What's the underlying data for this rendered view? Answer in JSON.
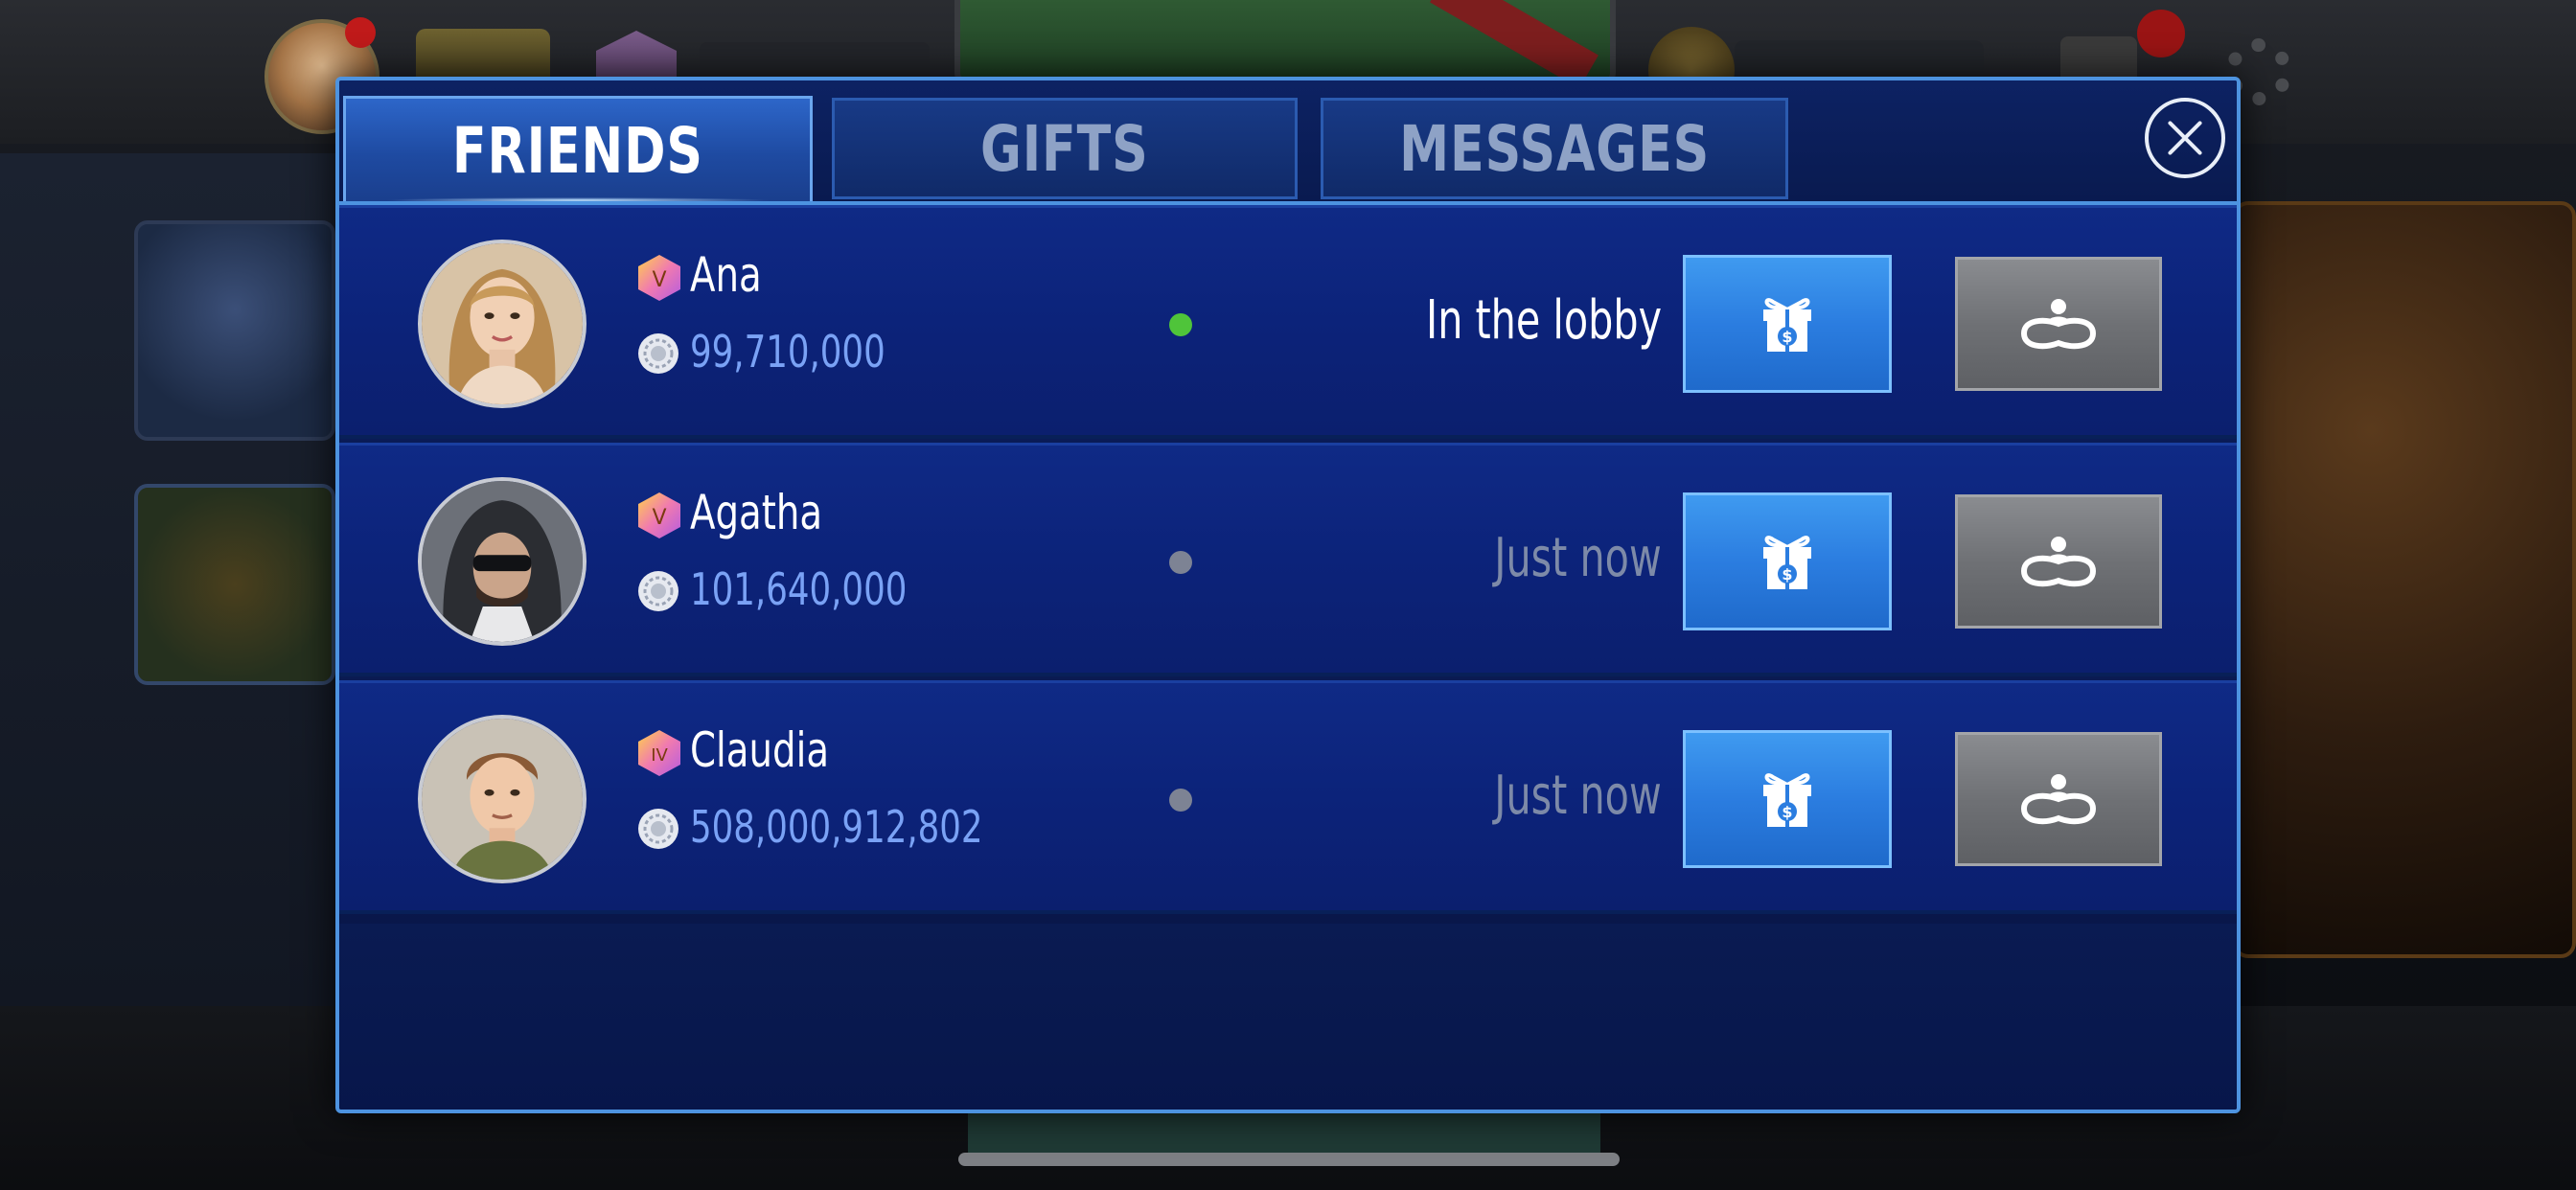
{
  "tabs": {
    "friends": "FRIENDS",
    "gifts": "GIFTS",
    "messages": "MESSAGES"
  },
  "friends": [
    {
      "name": "Ana",
      "vip_level": "V",
      "chips": "99,710,000",
      "status": "In the lobby",
      "online": true
    },
    {
      "name": "Agatha",
      "vip_level": "V",
      "chips": "101,640,000",
      "status": "Just now",
      "online": false
    },
    {
      "name": "Claudia",
      "vip_level": "IV",
      "chips": "508,000,912,802",
      "status": "Just now",
      "online": false
    }
  ],
  "colors": {
    "online_dot": "#4fc43a",
    "offline_dot": "#7d8394",
    "online_text": "#ffffff",
    "offline_text": "#7d8aa8",
    "chips_text": "#7aa2f5",
    "gift_button": "#2b7de0",
    "join_button": "#6f7175"
  },
  "icons": {
    "close": "close-icon",
    "gift": "gift-box-icon",
    "join": "join-table-icon",
    "chips": "chip-icon",
    "vip": "vip-badge-icon"
  }
}
